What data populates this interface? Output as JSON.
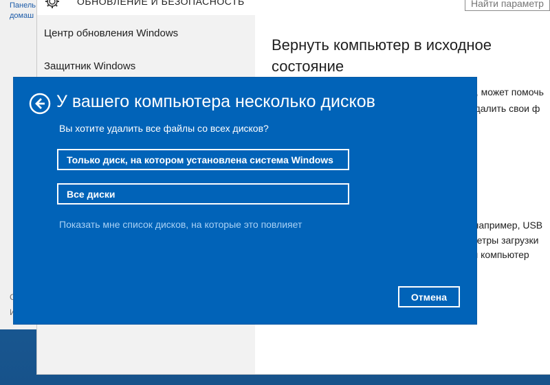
{
  "control_panel": {
    "line1": "Панель",
    "line2": "домаш",
    "gray1": "С",
    "gray2": "И"
  },
  "settings": {
    "header_title": "ОБНОВЛЕНИЕ И БЕЗОПАСНОСТЬ",
    "search_placeholder": "Найти параметр",
    "nav": [
      {
        "label": "Центр обновления Windows"
      },
      {
        "label": "Защитник Windows"
      }
    ],
    "content": {
      "title": "Вернуть компьютер в исходное состояние",
      "fragments": [
        "о, может помочь",
        "удалить свои ф",
        "(например, USB",
        "метры загрузки",
        "ш компьютер"
      ]
    }
  },
  "dialog": {
    "title": "У вашего компьютера несколько дисков",
    "question": "Вы хотите удалить все файлы со всех дисков?",
    "option_windows_drive": "Только диск, на котором установлена система Windows",
    "option_all_drives": "Все диски",
    "show_drives_link": "Показать мне список дисков, на которые это повлияет",
    "cancel_label": "Отмена"
  },
  "colors": {
    "dialog_bg": "#0163b8",
    "link_color": "#a9d1f5",
    "desktop_bg": "#1f6fb3"
  },
  "icons": {
    "back": "back-arrow-circle-icon",
    "settings": "gear-icon"
  }
}
